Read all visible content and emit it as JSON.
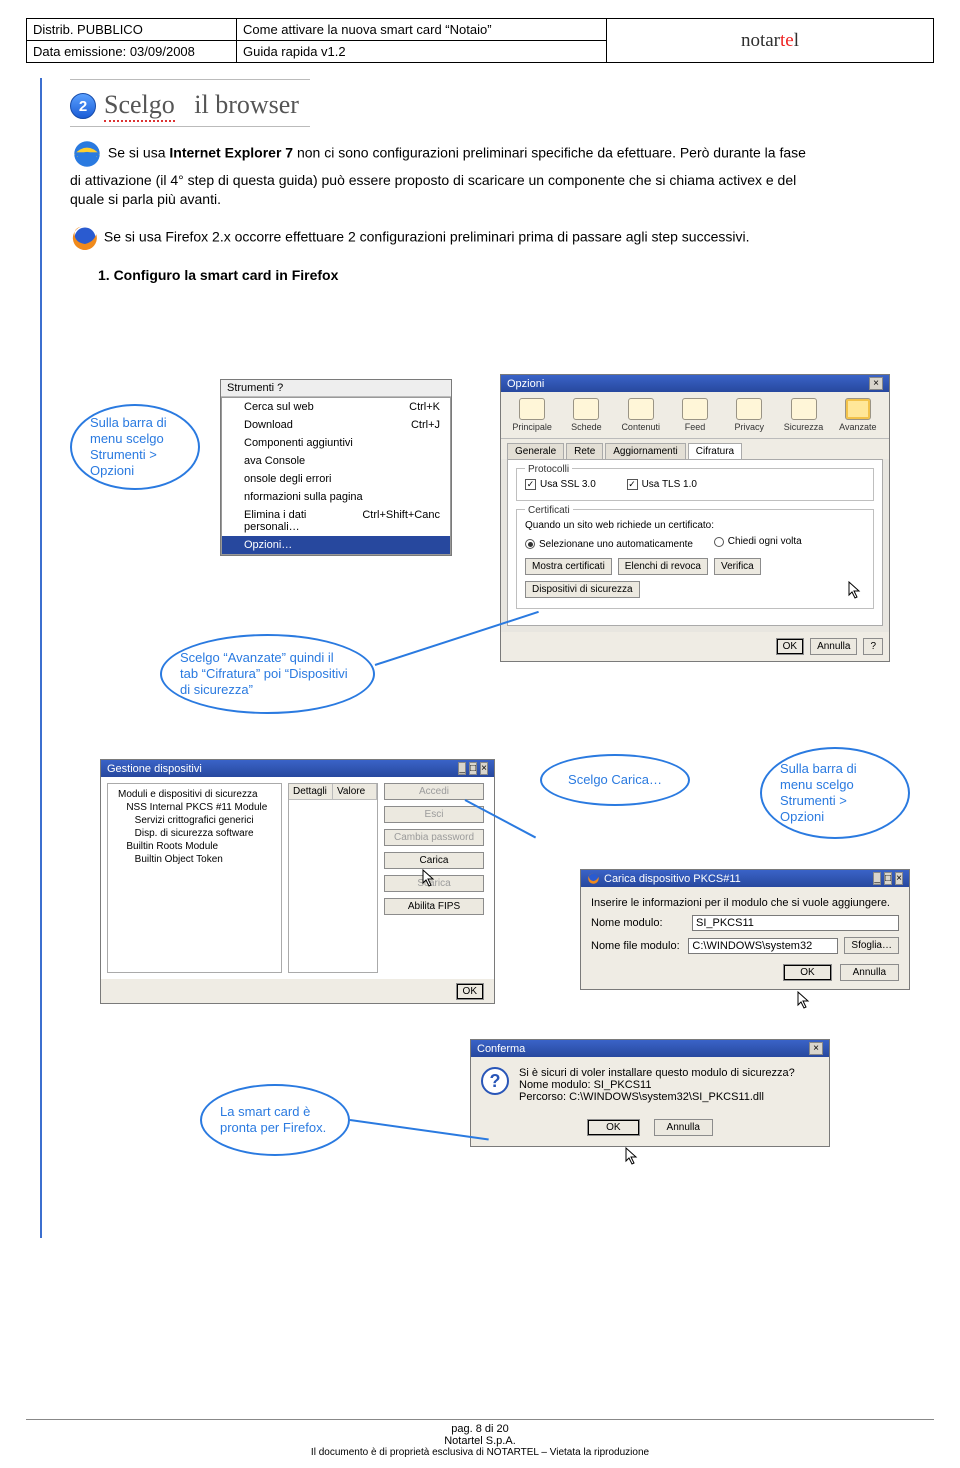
{
  "header": {
    "c1a": "Distrib. PUBBLICO",
    "c1b": "Data emissione: 03/09/2008",
    "c2a": "Come attivare la nuova smart card “Notaio”",
    "c2b": "Guida rapida v1.2",
    "brand_a": "notar",
    "brand_b": "te",
    "brand_c": "l"
  },
  "step": {
    "num": "2",
    "title_a": "Scelgo",
    "title_b": "il browser"
  },
  "p1a": "Se si usa ",
  "p1b": "Internet Explorer 7",
  "p1c": " non ci sono configurazioni preliminari specifiche da efettuare. Però durante la fase di attivazione (il 4° step di questa guida) può essere proposto di scaricare un componente che si chiama activex e del quale si parla più avanti.",
  "p2a": "Se si usa Firefox 2.x occorre effettuare 2 configurazioni preliminari prima di passare agli step successivi.",
  "numstep": "1. Configuro la smart card in Firefox",
  "callouts": {
    "c1": "Sulla barra di menu scelgo Strumenti > Opzioni",
    "c2": "Scelgo “Avanzate” quindi il tab “Cifratura” poi “Dispositivi di sicurezza”",
    "c3": "Scelgo Carica…",
    "c4": "Sulla barra di menu scelgo Strumenti > Opzioni",
    "c5": "La smart card è pronta per Firefox."
  },
  "strumenti_menu": {
    "bar": "Strumenti   ?",
    "items": [
      {
        "l": "Cerca sul web",
        "r": "Ctrl+K"
      },
      {
        "l": "Download",
        "r": "Ctrl+J"
      },
      {
        "l": "Componenti aggiuntivi",
        "r": ""
      },
      {
        "l": "ava Console",
        "r": ""
      },
      {
        "l": "onsole degli errori",
        "r": ""
      },
      {
        "l": "nformazioni sulla pagina",
        "r": ""
      },
      {
        "l": "Elimina i dati personali…",
        "r": "Ctrl+Shift+Canc"
      },
      {
        "l": "Opzioni…",
        "r": ""
      }
    ]
  },
  "opzioni": {
    "title": "Opzioni",
    "icons": [
      "Principale",
      "Schede",
      "Contenuti",
      "Feed",
      "Privacy",
      "Sicurezza",
      "Avanzate"
    ],
    "tabs": [
      "Generale",
      "Rete",
      "Aggiornamenti",
      "Cifratura"
    ],
    "proto_legend": "Protocolli",
    "ssl": "Usa SSL 3.0",
    "tls": "Usa TLS 1.0",
    "cert_legend": "Certificati",
    "cert_q": "Quando un sito web richiede un certificato:",
    "r1": "Selezionane uno automaticamente",
    "r2": "Chiedi ogni volta",
    "btns": [
      "Mostra certificati",
      "Elenchi di revoca",
      "Verifica",
      "Dispositivi di sicurezza"
    ],
    "ok": "OK",
    "ann": "Annulla",
    "q": "?"
  },
  "gest": {
    "title": "Gestione dispositivi",
    "tree": [
      "Moduli e dispositivi di sicurezza",
      "   NSS Internal PKCS #11 Module",
      "      Servizi crittografici generici",
      "      Disp. di sicurezza software",
      "   Builtin Roots Module",
      "      Builtin Object Token"
    ],
    "th1": "Dettagli",
    "th2": "Valore",
    "side": [
      "Accedi",
      "Esci",
      "Cambia password",
      "Carica",
      "Scarica",
      "Abilita FIPS"
    ],
    "ok": "OK"
  },
  "pk": {
    "title": "Carica dispositivo PKCS#11",
    "intro": "Inserire le informazioni per il modulo che si vuole aggiungere.",
    "l1": "Nome modulo:",
    "v1": "SI_PKCS11",
    "l2": "Nome file modulo:",
    "v2": "C:\\WINDOWS\\system32",
    "sf": "Sfoglia…",
    "ok": "OK",
    "ann": "Annulla"
  },
  "conf": {
    "title": "Conferma",
    "line1": "Si è sicuri di voler installare questo modulo di sicurezza?",
    "line2": "Nome modulo: SI_PKCS11",
    "line3": "Percorso: C:\\WINDOWS\\system32\\SI_PKCS11.dll",
    "ok": "OK",
    "ann": "Annulla"
  },
  "footer": {
    "pag": "pag. 8 di 20",
    "co": "Notartel S.p.A.",
    "note": "Il documento è di proprietà esclusiva di NOTARTEL – Vietata la riproduzione"
  }
}
